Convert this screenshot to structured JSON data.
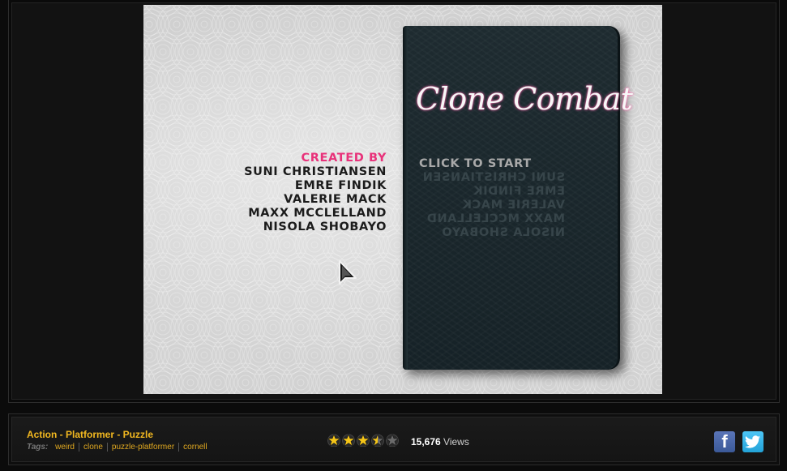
{
  "game": {
    "title": "Clone Combat",
    "credits_heading": "CREATED BY",
    "credits": [
      "SUNI CHRISTIANSEN",
      "EMRE FINDIK",
      "VALERIE MACK",
      "MAXX MCCLELLAND",
      "NISOLA SHOBAYO"
    ],
    "start_label": "CLICK TO START"
  },
  "info": {
    "categories": "Action - Platformer - Puzzle",
    "tags_label": "Tags:",
    "tags": [
      "weird",
      "clone",
      "puzzle-platformer",
      "cornell"
    ],
    "rating": 3.5,
    "rating_max": 5,
    "views_count": "15,676",
    "views_label": "Views"
  },
  "social": {
    "facebook_icon": "facebook-icon",
    "twitter_icon": "twitter-icon"
  },
  "colors": {
    "accent_pink": "#e8327a",
    "category_gold": "#f2b820",
    "book": "#1b272b",
    "facebook": "#3b5998",
    "twitter": "#23a3d8"
  }
}
